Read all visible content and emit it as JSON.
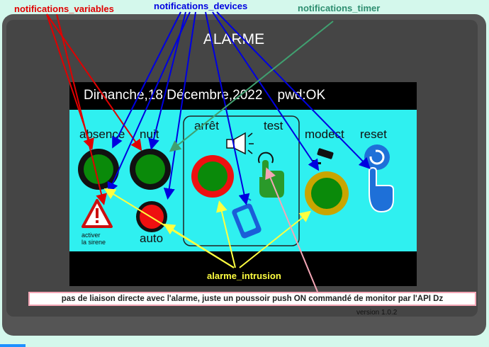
{
  "annotations": {
    "variables": "notifications_variables",
    "devices": "notifications_devices",
    "timer": "notifications_timer",
    "intrusion": "alarme_intrusion"
  },
  "panel": {
    "title": "ALARME",
    "date": "Dimanche,18 Décembre,2022",
    "pwd": "pwd:OK",
    "labels": {
      "absence": "absence",
      "nuit": "nuit",
      "arret": "arrêt",
      "test": "test",
      "modect": "modect",
      "reset": "reset",
      "auto": "auto",
      "activer": "activer",
      "sirene": "la sirene"
    }
  },
  "note": "pas de liaison directe avec l'alarme, juste un poussoir push ON commandé de monitor par l'API Dz",
  "version": "version 1.0.2",
  "colors": {
    "background": "#d4f8ec",
    "screen_cyan": "#2ff0f0",
    "variables_arrow": "#e00000",
    "devices_arrow": "#0000e0",
    "timer_arrow": "#40a070",
    "intrusion_arrow": "#ffff40",
    "note_arrow": "#f4a6b6"
  }
}
